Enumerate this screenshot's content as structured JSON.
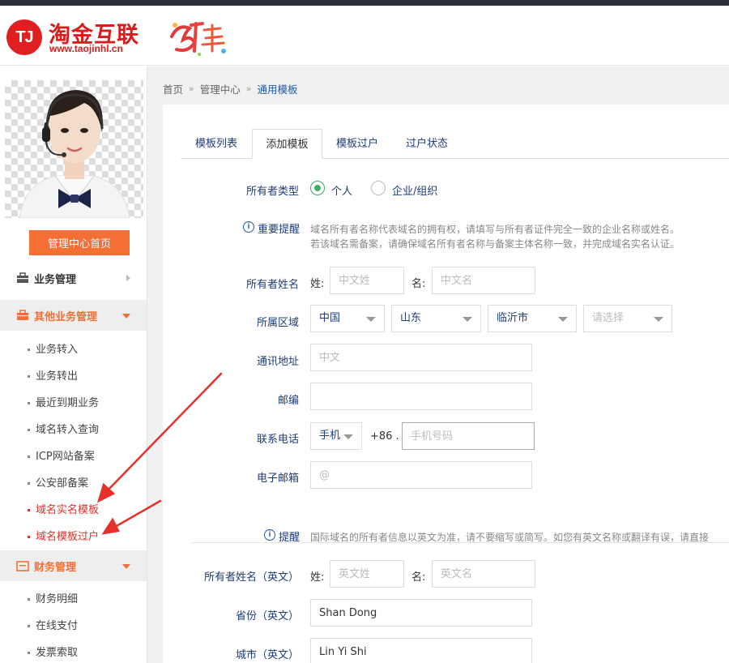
{
  "header": {
    "logo_mark": "TJ",
    "logo_name": "淘金互联",
    "logo_url": "www.taojinhl.cn"
  },
  "sidebar": {
    "home_button": "管理中心首页",
    "groups": [
      {
        "label": "业务管理",
        "icon": "briefcase-icon"
      },
      {
        "label": "其他业务管理",
        "icon": "briefcase-icon"
      },
      {
        "label": "财务管理",
        "icon": "wallet-icon"
      }
    ],
    "other_items": [
      "业务转入",
      "业务转出",
      "最近到期业务",
      "域名转入查询",
      "ICP网站备案",
      "公安部备案",
      "域名实名模板",
      "域名模板过户"
    ],
    "finance_items": [
      "财务明细",
      "在线支付",
      "发票索取"
    ]
  },
  "breadcrumb": {
    "home": "首页",
    "center": "管理中心",
    "current": "通用模板"
  },
  "tabs": [
    "模板列表",
    "添加模板",
    "模板过户",
    "过户状态"
  ],
  "form": {
    "owner_type": {
      "label": "所有者类型",
      "option_person": "个人",
      "option_org": "企业/组织"
    },
    "notice": {
      "title": "重要提醒",
      "line1": "域名所有者名称代表域名的拥有权，请填写与所有者证件完全一致的企业名称或姓名。",
      "line2": "若该域名需备案，请确保域名所有者名称与备案主体名称一致，并完成域名实名认证。"
    },
    "owner_name": {
      "label": "所有者姓名",
      "surname_label": "姓:",
      "surname_placeholder": "中文姓",
      "given_label": "名:",
      "given_placeholder": "中文名"
    },
    "region": {
      "label": "所属区域",
      "country": "中国",
      "province": "山东",
      "city": "临沂市",
      "district_placeholder": "请选择"
    },
    "address": {
      "label": "通讯地址",
      "placeholder": "中文"
    },
    "postcode": {
      "label": "邮编",
      "value": ""
    },
    "phone": {
      "label": "联系电话",
      "type": "手机",
      "prefix": "+86 .",
      "placeholder": "手机号码"
    },
    "email": {
      "label": "电子邮箱",
      "placeholder": "@"
    },
    "en_notice": {
      "title": "提醒",
      "text": "国际域名的所有者信息以英文为准，请不要缩写或简写。如您有英文名称或翻译有误，请直接"
    },
    "owner_name_en": {
      "label": "所有者姓名（英文）",
      "surname_label": "姓:",
      "surname_placeholder": "英文姓",
      "given_label": "名:",
      "given_placeholder": "英文名"
    },
    "province_en": {
      "label": "省份（英文）",
      "value": "Shan Dong"
    },
    "city_en": {
      "label": "城市（英文）",
      "value": "Lin Yi Shi"
    }
  },
  "colors": {
    "accent": "#f36f35",
    "link": "#1e3c7a",
    "radio": "#3db06a",
    "annotation_arrow": "#e8302a"
  }
}
